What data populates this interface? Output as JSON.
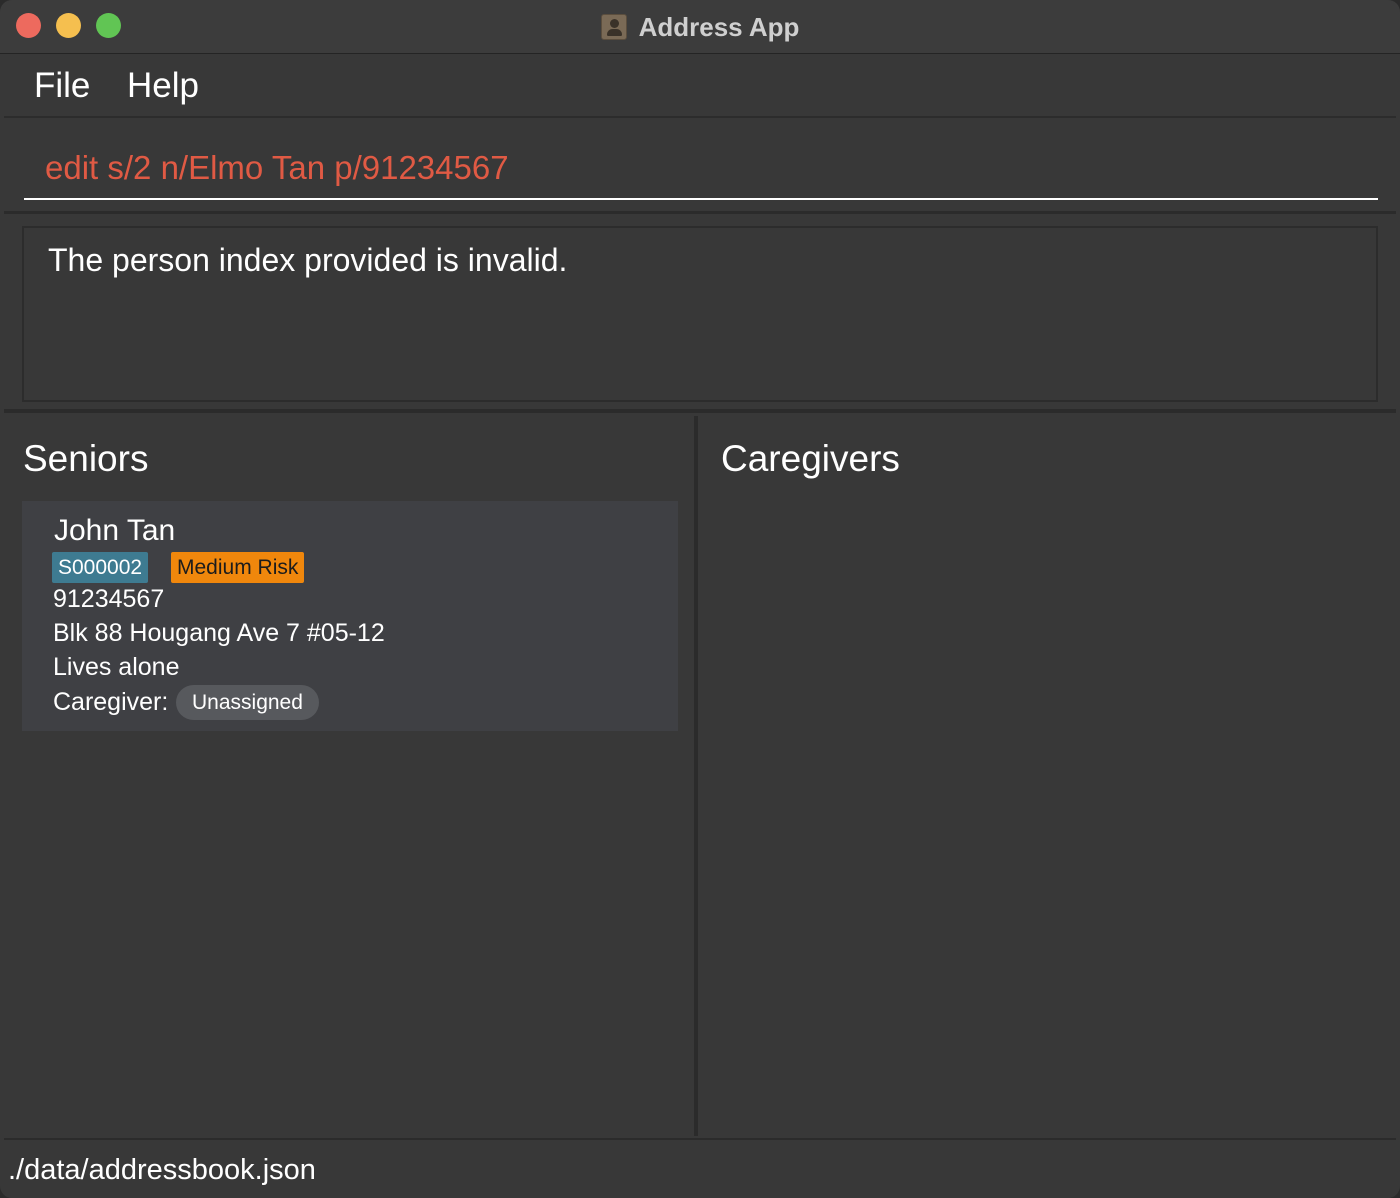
{
  "window": {
    "title": "Address App"
  },
  "menu": {
    "file_label": "File",
    "help_label": "Help"
  },
  "command": {
    "value": "edit s/2 n/Elmo Tan p/91234567",
    "text_color": "#e05a44"
  },
  "result": {
    "message": "The person index provided is invalid."
  },
  "seniors": {
    "title": "Seniors",
    "items": [
      {
        "name": "John Tan",
        "id_tag": "S000002",
        "risk_tag": "Medium Risk",
        "risk_color": "#f0870c",
        "phone": "91234567",
        "address": "Blk 88 Hougang Ave 7 #05-12",
        "living": "Lives alone",
        "caregiver_label": "Caregiver:",
        "caregiver_value": "Unassigned"
      }
    ]
  },
  "caregivers": {
    "title": "Caregivers",
    "items": []
  },
  "status": {
    "path": "./data/addressbook.json"
  },
  "icons": {
    "app": "address-book-icon"
  }
}
